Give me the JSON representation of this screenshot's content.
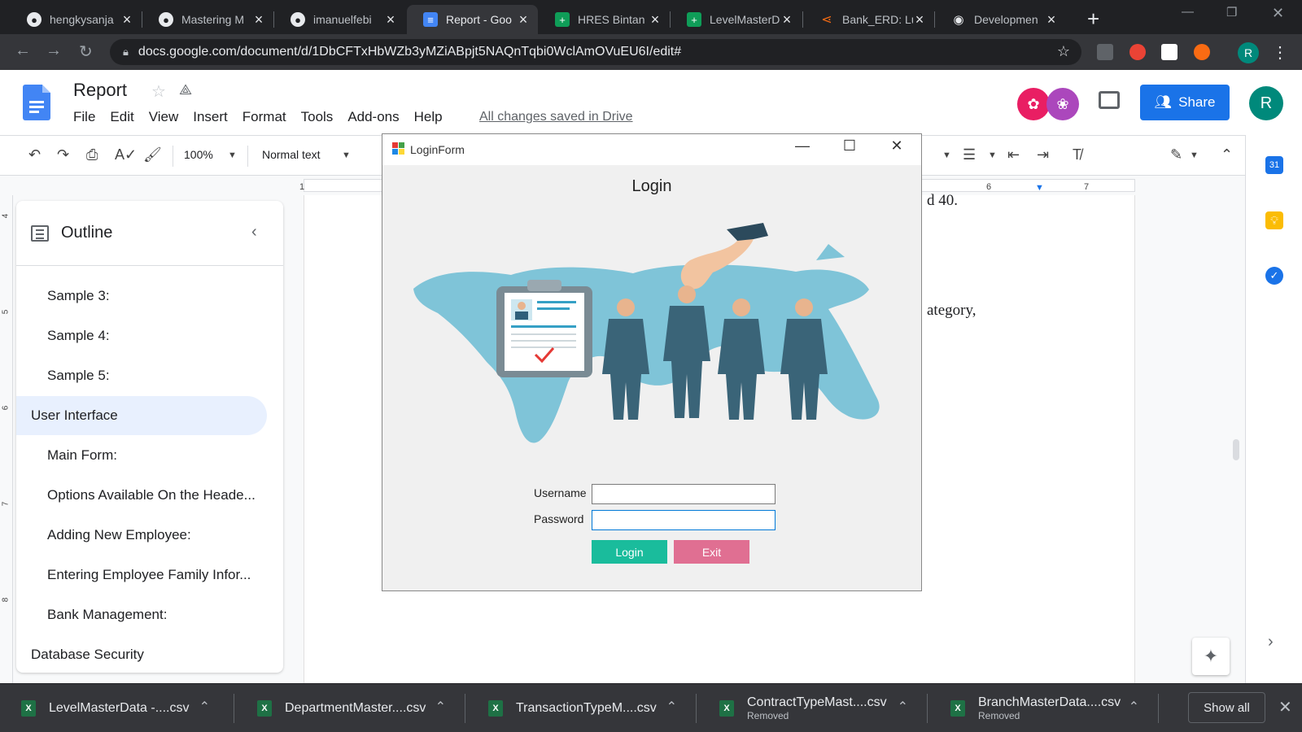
{
  "browser": {
    "tabs": [
      {
        "title": "hengkysanja",
        "icon": "github-icon",
        "active": false
      },
      {
        "title": "Mastering M",
        "icon": "github-icon",
        "active": false
      },
      {
        "title": "imanuelfebi",
        "icon": "github-icon",
        "active": false
      },
      {
        "title": "Report - Goo",
        "icon": "docs-icon",
        "active": true
      },
      {
        "title": "HRES Bintan",
        "icon": "sheets-icon",
        "active": false
      },
      {
        "title": "LevelMasterD",
        "icon": "sheets-icon",
        "active": false
      },
      {
        "title": "Bank_ERD: Lu",
        "icon": "lucidchart-icon",
        "active": false
      },
      {
        "title": "Developmen",
        "icon": "eye-icon",
        "active": false
      }
    ],
    "url": "docs.google.com/document/d/1DbCFTxHbWZb3yMZiABpjt5NAQnTqbi0WclAmOVuEU6I/edit#",
    "profile_initial": "R"
  },
  "docs": {
    "title": "Report",
    "menu": [
      "File",
      "Edit",
      "View",
      "Insert",
      "Format",
      "Tools",
      "Add-ons",
      "Help"
    ],
    "save_status": "All changes saved in Drive",
    "share_label": "Share",
    "account_initial": "R",
    "toolbar": {
      "zoom": "100%",
      "style": "Normal text"
    },
    "ruler_numbers": [
      "1",
      "6",
      "7"
    ],
    "vruler_numbers": [
      "4",
      "5",
      "6",
      "7",
      "8"
    ],
    "page_fragments": [
      "d 40.",
      "ategory,"
    ]
  },
  "outline": {
    "title": "Outline",
    "items": [
      {
        "label": "Sample 3:",
        "level": 2
      },
      {
        "label": "Sample 4:",
        "level": 2
      },
      {
        "label": "Sample 5:",
        "level": 2
      },
      {
        "label": "User Interface",
        "level": 1,
        "selected": true
      },
      {
        "label": "Main Form:",
        "level": 2
      },
      {
        "label": "Options Available On the Heade...",
        "level": 2
      },
      {
        "label": "Adding New Employee:",
        "level": 2
      },
      {
        "label": "Entering Employee Family Infor...",
        "level": 2
      },
      {
        "label": "Bank Management:",
        "level": 2
      },
      {
        "label": "Database Security",
        "level": 1
      }
    ]
  },
  "side_panel": {
    "calendar_label": "31"
  },
  "login_window": {
    "window_title": "LoginForm",
    "heading": "Login",
    "username_label": "Username",
    "password_label": "Password",
    "username_value": "",
    "password_value": "",
    "login_button": "Login",
    "exit_button": "Exit",
    "colors": {
      "login_button": "#1abc9c",
      "exit_button": "#e06f92",
      "map": "#7fc4d8"
    }
  },
  "downloads": {
    "items": [
      {
        "name": "LevelMasterData -....csv",
        "status": ""
      },
      {
        "name": "DepartmentMaster....csv",
        "status": ""
      },
      {
        "name": "TransactionTypeM....csv",
        "status": ""
      },
      {
        "name": "ContractTypeMast....csv",
        "status": "Removed"
      },
      {
        "name": "BranchMasterData....csv",
        "status": "Removed"
      }
    ],
    "show_all": "Show all"
  }
}
